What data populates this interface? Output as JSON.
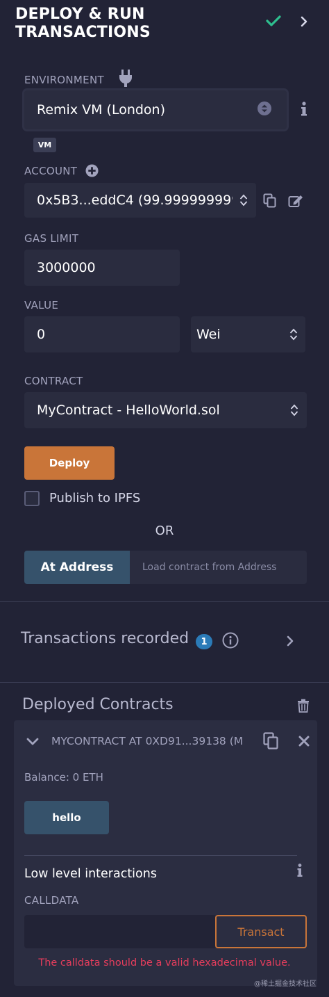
{
  "header": {
    "title": "DEPLOY & RUN\nTRANSACTIONS"
  },
  "environment": {
    "label": "ENVIRONMENT",
    "value": "Remix VM (London)",
    "badge": "VM"
  },
  "account": {
    "label": "ACCOUNT",
    "value": "0x5B3...eddC4 (99.999999999"
  },
  "gas_limit": {
    "label": "GAS LIMIT",
    "value": "3000000"
  },
  "value": {
    "label": "VALUE",
    "amount": "0",
    "unit": "Wei"
  },
  "contract": {
    "label": "CONTRACT",
    "value": "MyContract - HelloWorld.sol"
  },
  "deploy": {
    "button_label": "Deploy",
    "publish_label": "Publish to IPFS",
    "publish_checked": false
  },
  "or_label": "OR",
  "at_address": {
    "button_label": "At Address",
    "placeholder": "Load contract from Address"
  },
  "transactions": {
    "title": "Transactions recorded",
    "count": "1"
  },
  "deployed": {
    "title": "Deployed Contracts",
    "instance_title": "MYCONTRACT AT 0XD91...39138 (M",
    "balance": "Balance: 0 ETH",
    "method_button": "hello",
    "low_level_title": "Low level interactions",
    "calldata_label": "CALLDATA",
    "transact_label": "Transact",
    "error": "The calldata should be a valid hexadecimal value."
  },
  "watermark": "@稀土掘金技术社区",
  "colors": {
    "background": "#222336",
    "accent": "#c97539",
    "button_blue": "#36526b",
    "success": "#2ebf8f",
    "error": "#e53d5c",
    "badge": "#2b7bb8"
  }
}
